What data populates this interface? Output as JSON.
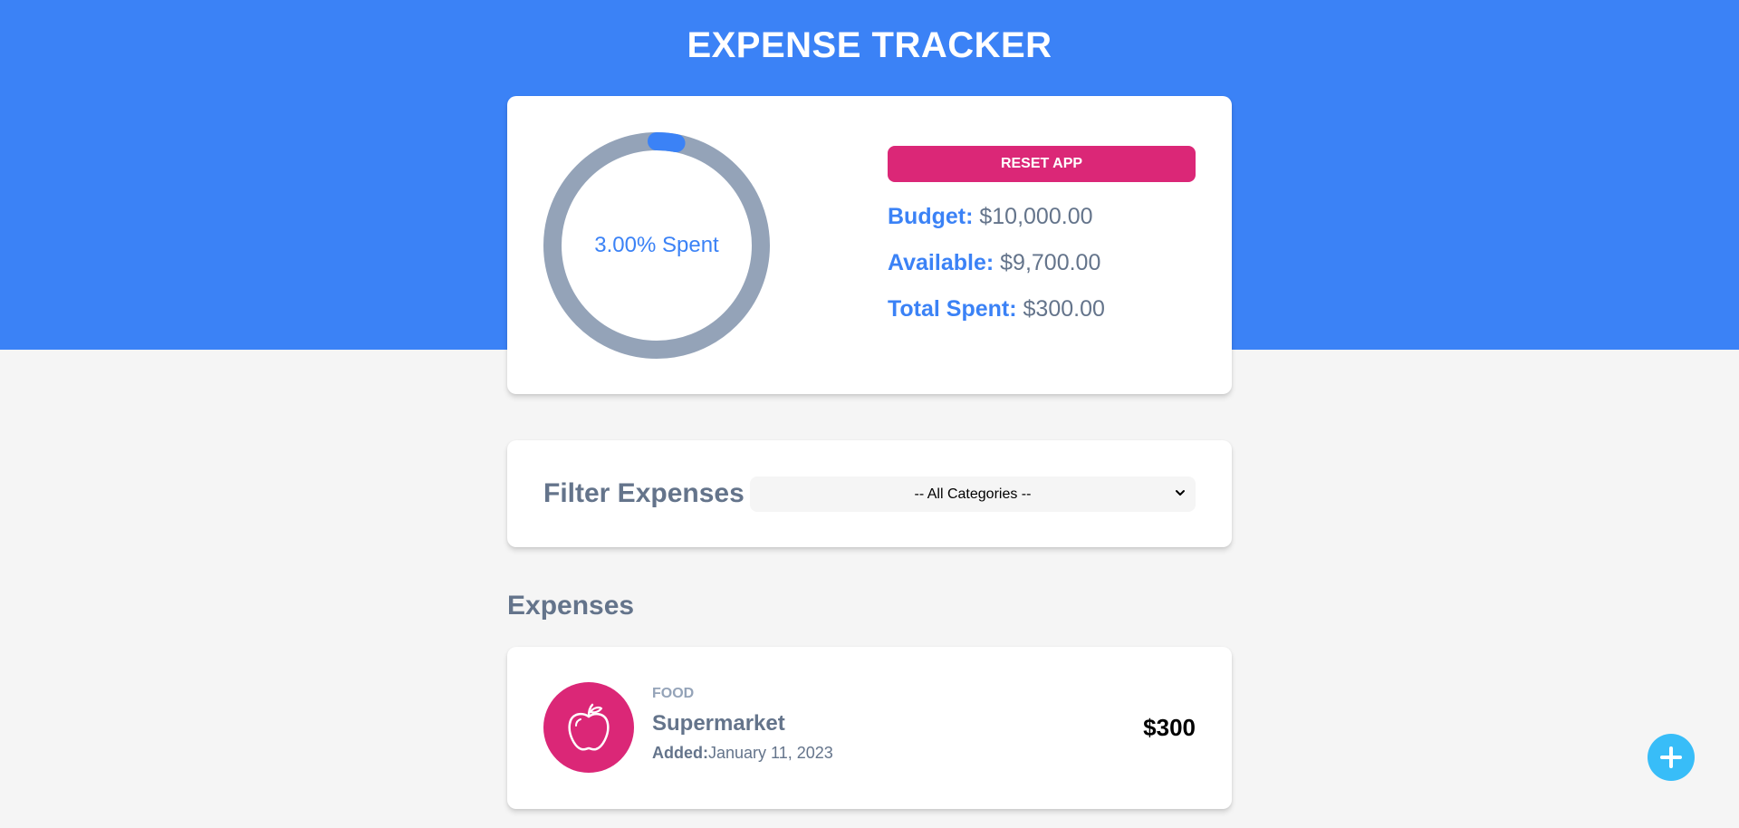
{
  "header": {
    "title": "EXPENSE TRACKER"
  },
  "budget_card": {
    "progress": {
      "label": "3.00% Spent",
      "percent_spent": 3.0
    },
    "reset_label": "RESET APP",
    "stats": {
      "budget_label": "Budget:",
      "budget_value": "$10,000.00",
      "available_label": "Available:",
      "available_value": "$9,700.00",
      "spent_label": "Total Spent:",
      "spent_value": "$300.00"
    }
  },
  "filter": {
    "label": "Filter Expenses",
    "selected_option": "-- All Categories --"
  },
  "expenses": {
    "title": "Expenses",
    "items": [
      {
        "category": "FOOD",
        "name": "Supermarket",
        "added_label": "Added:",
        "date": "January 11, 2023",
        "amount": "$300",
        "icon": "apple-icon"
      }
    ]
  },
  "fab": {
    "icon": "plus-icon"
  },
  "colors": {
    "primary": "#3b82f6",
    "accent": "#db2777",
    "muted_text": "#64748b",
    "track": "#94a3b8",
    "fab": "#38bdf8",
    "background": "#f5f5f5"
  }
}
